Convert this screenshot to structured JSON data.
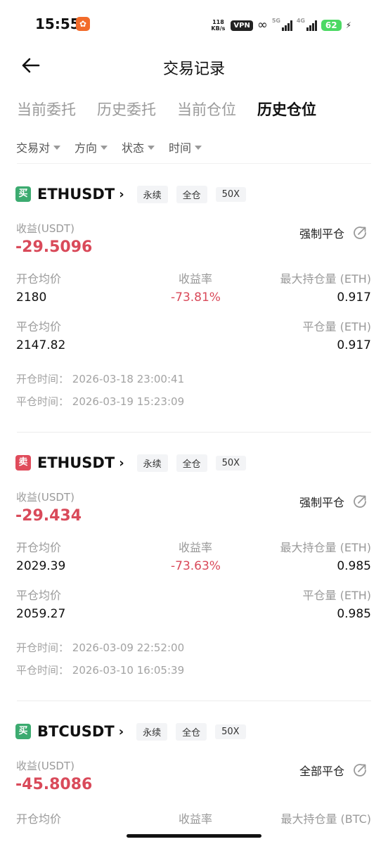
{
  "status_bar": {
    "time": "15:55",
    "speed_top": "118",
    "speed_bottom": "KB/s",
    "vpn": "VPN",
    "net_a": "5G",
    "net_b": "4G",
    "battery": "62"
  },
  "header": {
    "title": "交易记录"
  },
  "tabs": [
    {
      "label": "当前委托",
      "active": false
    },
    {
      "label": "历史委托",
      "active": false
    },
    {
      "label": "当前仓位",
      "active": false
    },
    {
      "label": "历史仓位",
      "active": true
    }
  ],
  "filters": [
    "交易对",
    "方向",
    "状态",
    "时间"
  ],
  "labels": {
    "pnl": "收益(USDT)",
    "open_price": "开仓均价",
    "roi": "收益率",
    "close_price": "平仓均价",
    "open_time": "开仓时间：",
    "close_time": "平仓时间："
  },
  "positions": [
    {
      "side": "买",
      "side_type": "buy",
      "symbol": "ETHUSDT",
      "tags": [
        "永续",
        "全仓",
        "50X"
      ],
      "pnl": "-29.5096",
      "close_type": "强制平仓",
      "open_price": "2180",
      "roi": "-73.81%",
      "max_label": "最大持仓量 (ETH)",
      "max_size": "0.917",
      "close_price": "2147.82",
      "closed_label": "平仓量 (ETH)",
      "closed_size": "0.917",
      "open_time": "2026-03-18 23:00:41",
      "close_time": "2026-03-19 15:23:09"
    },
    {
      "side": "卖",
      "side_type": "sell",
      "symbol": "ETHUSDT",
      "tags": [
        "永续",
        "全仓",
        "50X"
      ],
      "pnl": "-29.434",
      "close_type": "强制平仓",
      "open_price": "2029.39",
      "roi": "-73.63%",
      "max_label": "最大持仓量 (ETH)",
      "max_size": "0.985",
      "close_price": "2059.27",
      "closed_label": "平仓量 (ETH)",
      "closed_size": "0.985",
      "open_time": "2026-03-09 22:52:00",
      "close_time": "2026-03-10 16:05:39"
    },
    {
      "side": "买",
      "side_type": "buy",
      "symbol": "BTCUSDT",
      "tags": [
        "永续",
        "全仓",
        "50X"
      ],
      "pnl": "-45.8086",
      "close_type": "全部平仓",
      "max_label": "最大持仓量 (BTC)"
    }
  ],
  "colors": {
    "loss": "#d94a5a",
    "buy": "#3cab70",
    "sell": "#e04b5b"
  }
}
